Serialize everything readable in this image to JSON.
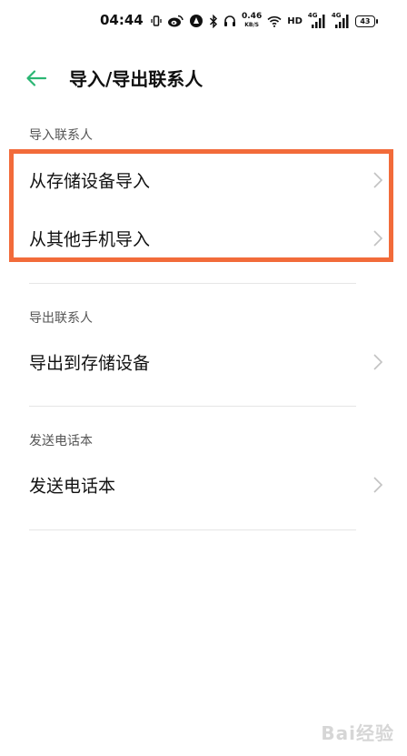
{
  "status_bar": {
    "time": "04:44",
    "net_speed_value": "0.46",
    "net_speed_unit": "KB/S",
    "hd_label": "HD",
    "signal_1_tag": "4G",
    "signal_2_tag": "4G",
    "battery_level": "43",
    "icons": [
      "vibrate-icon",
      "weibo-icon",
      "app-icon",
      "bluetooth-icon",
      "headset-icon",
      "wifi-icon",
      "signal-icon",
      "signal-icon",
      "battery-icon"
    ]
  },
  "header": {
    "title": "导入/导出联系人",
    "back_icon": "back-arrow-icon",
    "accent_color": "#2bb673"
  },
  "sections": [
    {
      "label": "导入联系人",
      "items": [
        {
          "label": "从存储设备导入"
        },
        {
          "label": "从其他手机导入"
        }
      ]
    },
    {
      "label": "导出联系人",
      "items": [
        {
          "label": "导出到存储设备"
        }
      ]
    },
    {
      "label": "发送电话本",
      "items": [
        {
          "label": "发送电话本"
        }
      ]
    }
  ],
  "highlight_color": "#f26b3a",
  "watermark": "Bai经验"
}
